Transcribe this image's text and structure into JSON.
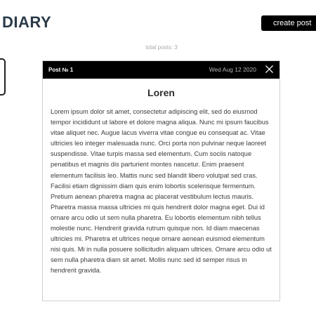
{
  "header": {
    "title": "DIARY",
    "create_label": "create post"
  },
  "summary": {
    "total_posts": "total posts: 3"
  },
  "post": {
    "number": "Post № 1",
    "date": "Wed Aug 12 2020",
    "close_icon": "close-icon",
    "title": "Loren",
    "body": "Lorem ipsum dolor sit amet, consectetur adipiscing elit, sed do eiusmod tempor incididunt ut labore et dolore magna aliqua. Nunc mi ipsum faucibus vitae aliquet nec. Augue lacus viverra vitae congue eu consequat ac. Vitae ultricies leo integer malesuada nunc. Orci porta non pulvinar neque laoreet suspendisse. Vitae turpis massa sed elementum. Cum sociis natoque penatibus et magnis dis parturient montes nascetur. Enim praesent elementum facilisis leo. Mattis nunc sed blandit libero volutpat sed cras. Facilisi etiam dignissim diam quis enim lobortis scelerisque fermentum. Pretium aenean pharetra magna ac placerat vestibulum lectus mauris. Pharetra massa massa ultricies mi quis hendrerit dolor magna eget. Dui id ornare arcu odio ut sem nulla pharetra. Eu lobortis elementum nibh tellus molestie nunc. Hendrerit gravida rutrum quisque non. Id diam maecenas ultricies mi. Pharetra et ultrices neque ornare aenean euismod elementum nisi quis. Mi in nulla posuere sollicitudin aliquam ultrices. Ornare arcu odio ut sem nulla pharetra diam sit amet. Mollis nunc sed id semper risus in hendrerit gravida."
  },
  "colors": {
    "title_text": "#2b3a4a",
    "header_bar": "#000000",
    "muted_text": "#a9a9a9"
  }
}
